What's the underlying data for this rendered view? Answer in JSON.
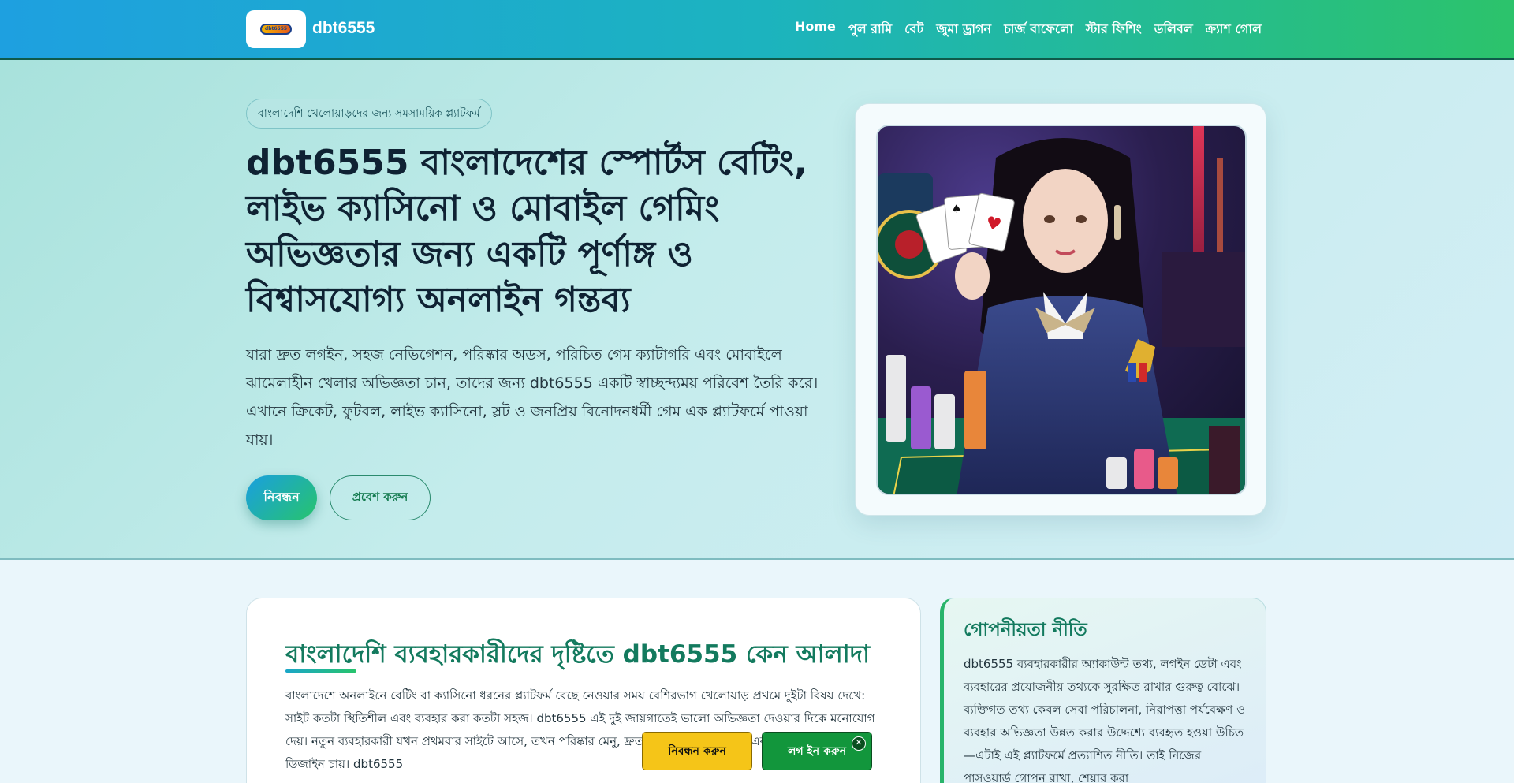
{
  "header": {
    "logo_text": "dbt6555",
    "brand": "dbt6555",
    "nav": [
      {
        "label": "Home"
      },
      {
        "label": "পুল রামি"
      },
      {
        "label": "বেট"
      },
      {
        "label": "জুমা ড্রাগন"
      },
      {
        "label": "চার্জ বাফেলো"
      },
      {
        "label": "স্টার ফিশিং"
      },
      {
        "label": "ডলিবল"
      },
      {
        "label": "ক্র্যাশ গোল"
      }
    ]
  },
  "hero": {
    "tag": "বাংলাদেশি খেলোয়াড়দের জন্য সমসাময়িক প্ল্যাটফর্ম",
    "title": "dbt6555 বাংলাদেশের স্পোর্টস বেটিং, লাইভ ক্যাসিনো ও মোবাইল গেমিং অভিজ্ঞতার জন্য একটি পূর্ণাঙ্গ ও বিশ্বাসযোগ্য অনলাইন গন্তব্য",
    "description": "যারা দ্রুত লগইন, সহজ নেভিগেশন, পরিষ্কার অডস, পরিচিত গেম ক্যাটাগরি এবং মোবাইলে ঝামেলাহীন খেলার অভিজ্ঞতা চান, তাদের জন্য dbt6555 একটি স্বাচ্ছন্দ্যময় পরিবেশ তৈরি করে। এখানে ক্রিকেট, ফুটবল, লাইভ ক্যাসিনো, স্লট ও জনপ্রিয় বিনোদনধর্মী গেম এক প্ল্যাটফর্মে পাওয়া যায়।",
    "register_label": "নিবন্ধন",
    "login_label": "প্রবেশ করুন"
  },
  "main": {
    "section_title": "বাংলাদেশি ব্যবহারকারীদের দৃষ্টিতে dbt6555 কেন আলাদা",
    "section_text": "বাংলাদেশে অনলাইনে বেটিং বা ক্যাসিনো ধরনের প্ল্যাটফর্ম বেছে নেওয়ার সময় বেশিরভাগ খেলোয়াড় প্রথমে দুইটা বিষয় দেখে: সাইট কতটা স্থিতিশীল এবং ব্যবহার করা কতটা সহজ। dbt6555 এই দুই জায়গাতেই ভালো অভিজ্ঞতা দেওয়ার দিকে মনোযোগ দেয়। নতুন ব্যবহারকারী যখন প্রথমবার সাইটে আসে, তখন পরিষ্কার মেনু, দ্রুত লোডিং, সহজ লগইন এবং মোবাইল-ফ্রেন্ডলি ডিজাইন চায়। dbt6555"
  },
  "sidebar": {
    "title": "গোপনীয়তা নীতি",
    "text": "dbt6555 ব্যবহারকারীর অ্যাকাউন্ট তথ্য, লগইন ডেটা এবং ব্যবহারের প্রয়োজনীয় তথ্যকে সুরক্ষিত রাখার গুরুত্ব বোঝে। ব্যক্তিগত তথ্য কেবল সেবা পরিচালনা, নিরাপত্তা পর্যবেক্ষণ ও ব্যবহার অভিজ্ঞতা উন্নত করার উদ্দেশ্যে ব্যবহৃত হওয়া উচিত—এটাই এই প্ল্যাটফর্মে প্রত্যাশিত নীতি। তাই নিজের পাসওয়ার্ড গোপন রাখা, শেয়ার করা"
  },
  "sticky": {
    "register_label": "নিবন্ধন করুন",
    "login_label": "লগ ইন করুন",
    "close_label": "✕"
  },
  "colors": {
    "header_start": "#1ea0e0",
    "header_end": "#2cc36b",
    "accent_green": "#137a5e",
    "sticky_yellow": "#f5c518",
    "sticky_green": "#12963c"
  }
}
